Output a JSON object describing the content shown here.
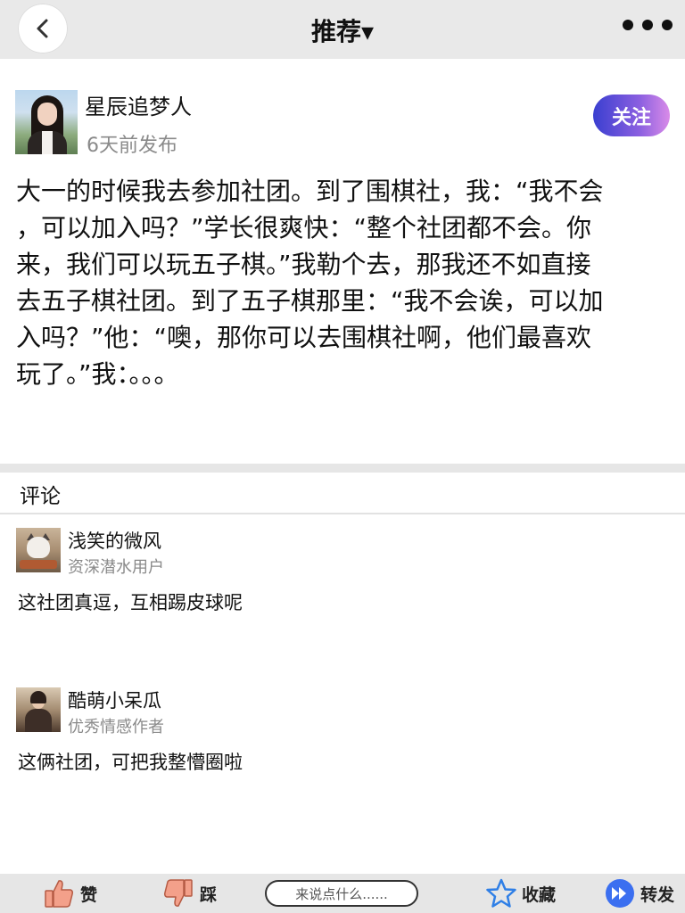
{
  "header": {
    "title": "推荐▾",
    "back_icon": "chevron-left-icon",
    "more_icon": "more-dots-icon"
  },
  "post": {
    "author": "星辰追梦人",
    "time": "6天前发布",
    "follow_label": "关注",
    "lines": [
      "大一的时候我去参加社团。到了围棋社，我：“我不会",
      "，可以加入吗？”学长很爽快：“整个社团都不会。你",
      "来，我们可以玩五子棋。”我勒个去，那我还不如直接",
      "去五子棋社团。到了五子棋那里：“我不会诶，可以加",
      "入吗？”他：“噢，那你可以去围棋社啊，他们最喜欢",
      "玩了。”我：。。。"
    ]
  },
  "comments": {
    "heading": "评论",
    "items": [
      {
        "name": "浅笑的微风",
        "role": "资深潜水用户",
        "text": "这社团真逗，互相踢皮球呢"
      },
      {
        "name": "酷萌小呆瓜",
        "role": "优秀情感作者",
        "text": "这俩社团，可把我整懵圈啦"
      }
    ]
  },
  "bottom_bar": {
    "like_label": "赞",
    "dislike_label": "踩",
    "input_placeholder": "来说点什么......",
    "favorite_label": "收藏",
    "share_label": "转发"
  },
  "colors": {
    "accent_start": "#3a3fd0",
    "accent_end": "#d98be8",
    "star": "#2f7fe6",
    "thumb": "#f3a08a"
  }
}
